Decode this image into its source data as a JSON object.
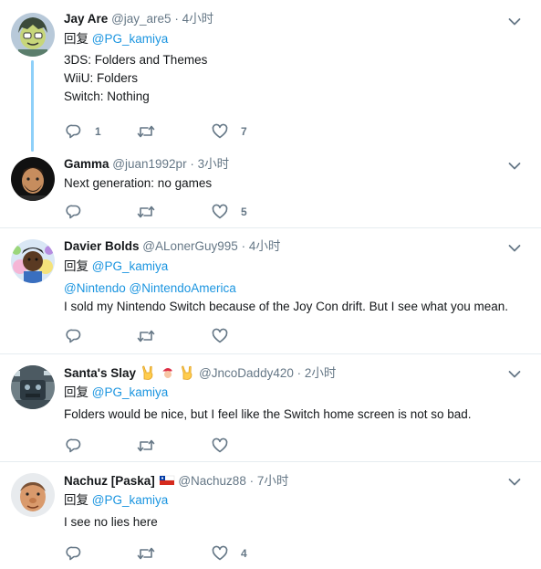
{
  "tweets": [
    {
      "name": "Jay Are",
      "handle": "@jay_are5",
      "dot": "·",
      "time": "4小时",
      "reply_label": "回复",
      "reply_to": "@PG_kamiya",
      "lines": [
        "3DS: Folders and Themes",
        "WiiU: Folders",
        "Switch: Nothing"
      ],
      "reply_count": "1",
      "retweet_count": "",
      "like_count": "7"
    },
    {
      "name": "Gamma",
      "handle": "@juan1992pr",
      "dot": "·",
      "time": "3小时",
      "lines": [
        "Next generation: no games"
      ],
      "reply_count": "",
      "retweet_count": "",
      "like_count": "5"
    },
    {
      "name": "Davier Bolds",
      "handle": "@ALonerGuy995",
      "dot": "·",
      "time": "4小时",
      "reply_label": "回复",
      "reply_to": "@PG_kamiya",
      "mentions": [
        "@Nintendo",
        "@NintendoAmerica"
      ],
      "lines": [
        "I sold my Nintendo Switch because of the Joy Con drift. But I see what you mean."
      ],
      "reply_count": "",
      "retweet_count": "",
      "like_count": ""
    },
    {
      "name": "Santa's Slay",
      "handle": "@JncoDaddy420",
      "dot": "·",
      "time": "2小时",
      "reply_label": "回复",
      "reply_to": "@PG_kamiya",
      "name_emojis": [
        "metal-hand-emoji",
        "santa-emoji",
        "metal-hand-emoji"
      ],
      "lines": [
        "Folders would be nice, but I feel like the Switch home screen is not so bad."
      ],
      "reply_count": "",
      "retweet_count": "",
      "like_count": ""
    },
    {
      "name": "Nachuz [Paska]",
      "handle": "@Nachuz88",
      "dot": "·",
      "time": "7小时",
      "reply_label": "回复",
      "reply_to": "@PG_kamiya",
      "name_emojis": [
        "chile-flag-emoji"
      ],
      "lines": [
        "I see no lies here"
      ],
      "reply_count": "",
      "retweet_count": "",
      "like_count": "4"
    }
  ],
  "icons": {
    "reply": "reply-icon",
    "retweet": "retweet-icon",
    "like": "heart-icon",
    "more": "chevron-down-icon"
  },
  "colors": {
    "link": "#1b95e0",
    "muted": "#657786",
    "text": "#14171a",
    "divider": "#e6ecf0",
    "thread": "#8ed0f9"
  }
}
